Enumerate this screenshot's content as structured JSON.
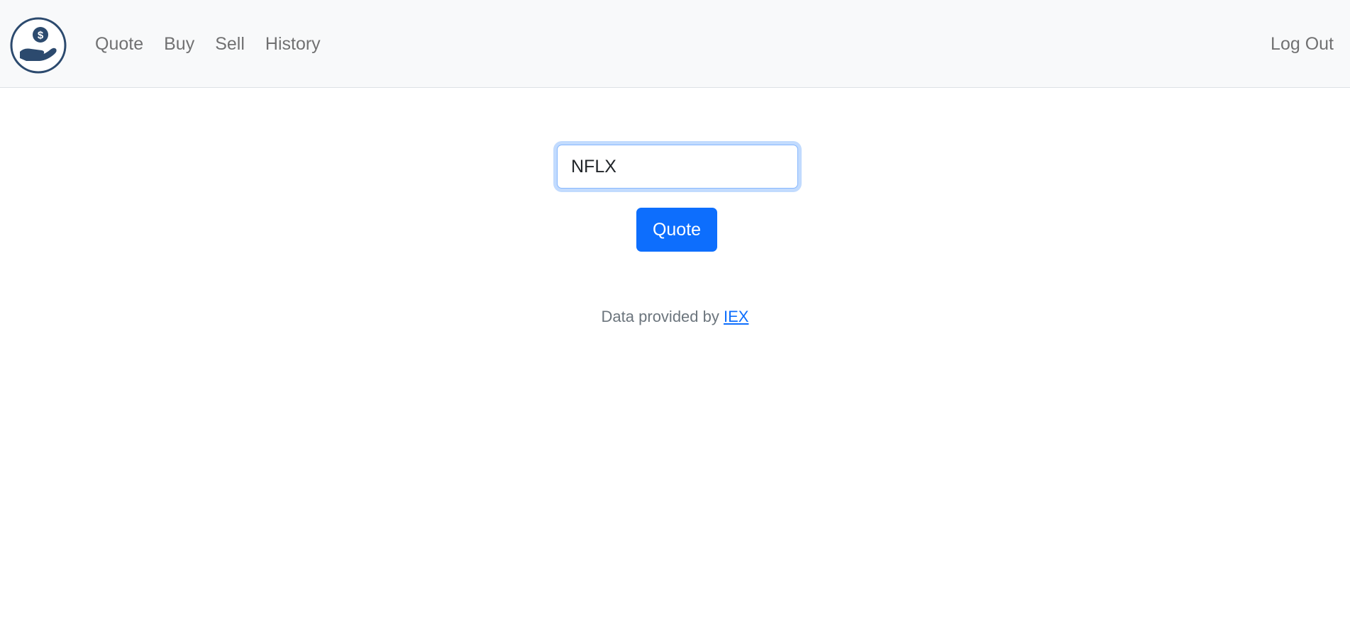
{
  "navbar": {
    "logo_icon": "hand-holding-dollar-icon",
    "links": [
      {
        "label": "Quote"
      },
      {
        "label": "Buy"
      },
      {
        "label": "Sell"
      },
      {
        "label": "History"
      }
    ],
    "logout_label": "Log Out"
  },
  "form": {
    "symbol_value": "NFLX",
    "submit_label": "Quote"
  },
  "footer": {
    "text": "Data provided by",
    "link_label": "IEX"
  },
  "colors": {
    "primary": "#0d6efd",
    "navbar_bg": "#f8f9fa",
    "logo_navy": "#2c4a6e"
  }
}
